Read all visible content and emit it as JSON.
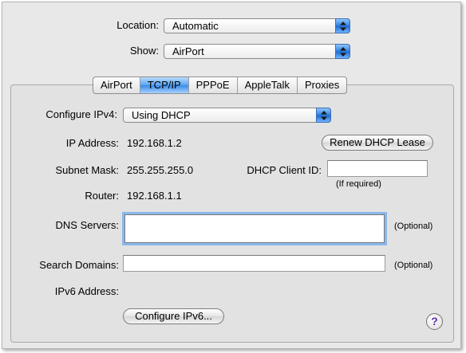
{
  "top": {
    "location_label": "Location:",
    "location_value": "Automatic",
    "show_label": "Show:",
    "show_value": "AirPort"
  },
  "tabs": [
    {
      "label": "AirPort",
      "active": false
    },
    {
      "label": "TCP/IP",
      "active": true
    },
    {
      "label": "PPPoE",
      "active": false
    },
    {
      "label": "AppleTalk",
      "active": false
    },
    {
      "label": "Proxies",
      "active": false
    }
  ],
  "tcpip": {
    "configure_label": "Configure IPv4:",
    "configure_value": "Using DHCP",
    "ip_label": "IP Address:",
    "ip_value": "192.168.1.2",
    "renew_button": "Renew DHCP Lease",
    "subnet_label": "Subnet Mask:",
    "subnet_value": "255.255.255.0",
    "client_id_label": "DHCP Client ID:",
    "client_id_value": "",
    "client_id_note": "(If required)",
    "router_label": "Router:",
    "router_value": "192.168.1.1",
    "dns_label": "DNS Servers:",
    "dns_value": "",
    "dns_note": "(Optional)",
    "search_label": "Search Domains:",
    "search_value": "",
    "search_note": "(Optional)",
    "ipv6_label": "IPv6 Address:",
    "ipv6_value": "",
    "configure_ipv6_button": "Configure IPv6...",
    "help_glyph": "?"
  },
  "icons": {
    "popup": "up-down-arrows-icon",
    "help": "help-icon"
  },
  "colors": {
    "accent": "#3b8ae8",
    "focus_ring": "#8ab8ea",
    "help_mark": "#5a2ea6"
  }
}
